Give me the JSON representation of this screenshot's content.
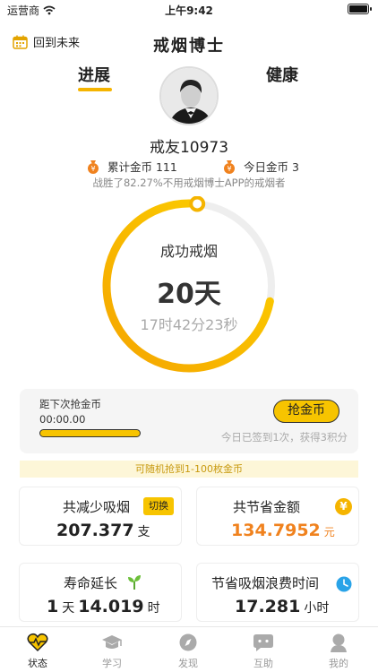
{
  "status_bar": {
    "carrier": "运营商",
    "time": "上午9:42"
  },
  "header": {
    "back_label": "回到未来",
    "title": "戒烟博士"
  },
  "top_tabs": [
    {
      "label": "进展",
      "active": true
    },
    {
      "label": "健康",
      "active": false
    }
  ],
  "profile": {
    "username": "戒友10973",
    "total_coins": "累计金币 111",
    "today_coins": "今日金币 3",
    "beat_text": "战胜了82.27%不用戒烟博士APP的戒烟者"
  },
  "progress_ring": {
    "label": "成功戒烟",
    "days": "20天",
    "timer": "17时42分23秒",
    "fraction": 0.72,
    "color_start": "#f5a500",
    "color_end": "#fcd200"
  },
  "grab_coins": {
    "title": "距下次抢金币",
    "countdown": "00:00.00",
    "button": "抢金币",
    "sign_text": "今日已签到1次，获得3积分",
    "bar_fraction": 1.0
  },
  "random_banner": "可随机抢到1-100枚金币",
  "stats": {
    "reduced": {
      "label": "共减少吸烟",
      "switch": "切换",
      "value": "207.377",
      "unit": "支"
    },
    "saved": {
      "label": "共节省金额",
      "icon": "yen-icon",
      "value": "134.7952",
      "unit": "元"
    },
    "life": {
      "label": "寿命延长",
      "icon": "sprout-icon",
      "value_prefix": "1",
      "prefix_unit": "天",
      "value": "14.019",
      "unit": "时"
    },
    "time_saved": {
      "label": "节省吸烟浪费时间",
      "icon": "clock-icon",
      "value": "17.281",
      "unit": "小时"
    }
  },
  "bottom_tabs": [
    {
      "label": "状态",
      "icon": "heart-pulse-icon",
      "active": true
    },
    {
      "label": "学习",
      "icon": "graduation-cap-icon",
      "active": false
    },
    {
      "label": "发现",
      "icon": "compass-icon",
      "active": false
    },
    {
      "label": "互助",
      "icon": "chat-icon",
      "active": false
    },
    {
      "label": "我的",
      "icon": "person-icon",
      "active": false
    }
  ],
  "colors": {
    "accent": "#f7c400",
    "orange": "#f0821e",
    "gray_text": "#888888"
  }
}
